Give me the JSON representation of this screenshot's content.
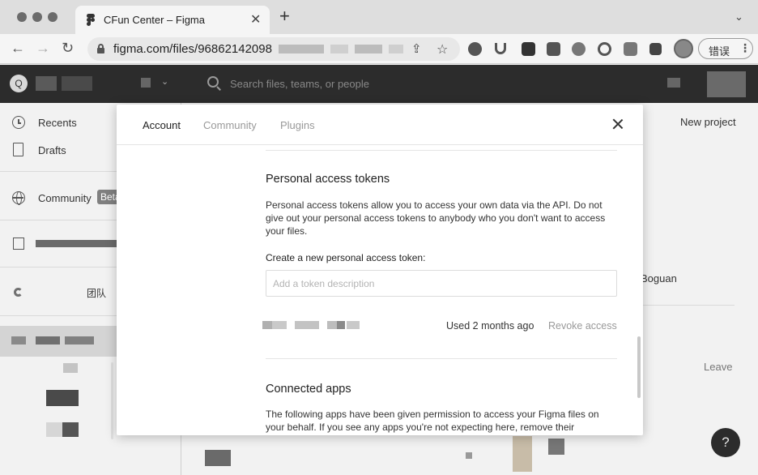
{
  "browser": {
    "tab_title": "CFun Center – Figma",
    "tab_close": "✕",
    "new_tab": "+",
    "tab_menu": "⌄",
    "back": "←",
    "forward": "→",
    "reload": "↻",
    "url_visible": "figma.com/files/96862142098",
    "share_icon": "⇪",
    "star_icon": "☆",
    "error_pill_label": "错误",
    "error_pill_menu": "⋮"
  },
  "figma_header": {
    "avatar_letter": "Q",
    "search_placeholder": "Search files, teams, or people"
  },
  "sidebar": {
    "recents": "Recents",
    "drafts": "Drafts",
    "community": "Community",
    "community_badge": "Beta",
    "team_label": "团队"
  },
  "main": {
    "new_project": "New project",
    "member_name_fragment": "Boguan",
    "leave": "Leave",
    "help": "?"
  },
  "modal": {
    "tabs": [
      {
        "label": "Account"
      },
      {
        "label": "Community"
      },
      {
        "label": "Plugins"
      }
    ],
    "pat_heading": "Personal access tokens",
    "pat_description": "Personal access tokens allow you to access your own data via the API. Do not give out your personal access tokens to anybody who you don't want to access your files.",
    "create_label": "Create a new personal access token:",
    "token_placeholder": "Add a token description",
    "token_used": "Used 2 months ago",
    "token_revoke": "Revoke access",
    "connected_heading": "Connected apps",
    "connected_description": "The following apps have been given permission to access your Figma files on your behalf. If you see any apps you're not expecting here, remove their"
  }
}
